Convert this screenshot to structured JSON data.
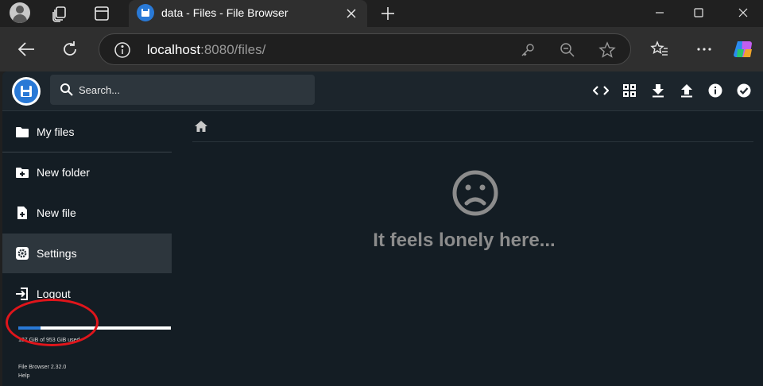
{
  "browser": {
    "tab": {
      "title": "data - Files - File Browser"
    },
    "address": {
      "host": "localhost",
      "path": ":8080/files/"
    }
  },
  "app": {
    "search": {
      "placeholder": "Search..."
    },
    "sidebar": {
      "items": [
        {
          "label": "My files"
        },
        {
          "label": "New folder"
        },
        {
          "label": "New file"
        },
        {
          "label": "Settings"
        },
        {
          "label": "Logout"
        }
      ],
      "quota": {
        "text": "137 GiB of 953 GiB used",
        "used_fraction": 0.144
      },
      "version": "File Browser 2.32.0",
      "help": "Help"
    },
    "main": {
      "empty_message": "It feels lonely here..."
    }
  },
  "colors": {
    "accent": "#2979d6",
    "annotation": "#e0151b",
    "app_background": "#141d24"
  }
}
